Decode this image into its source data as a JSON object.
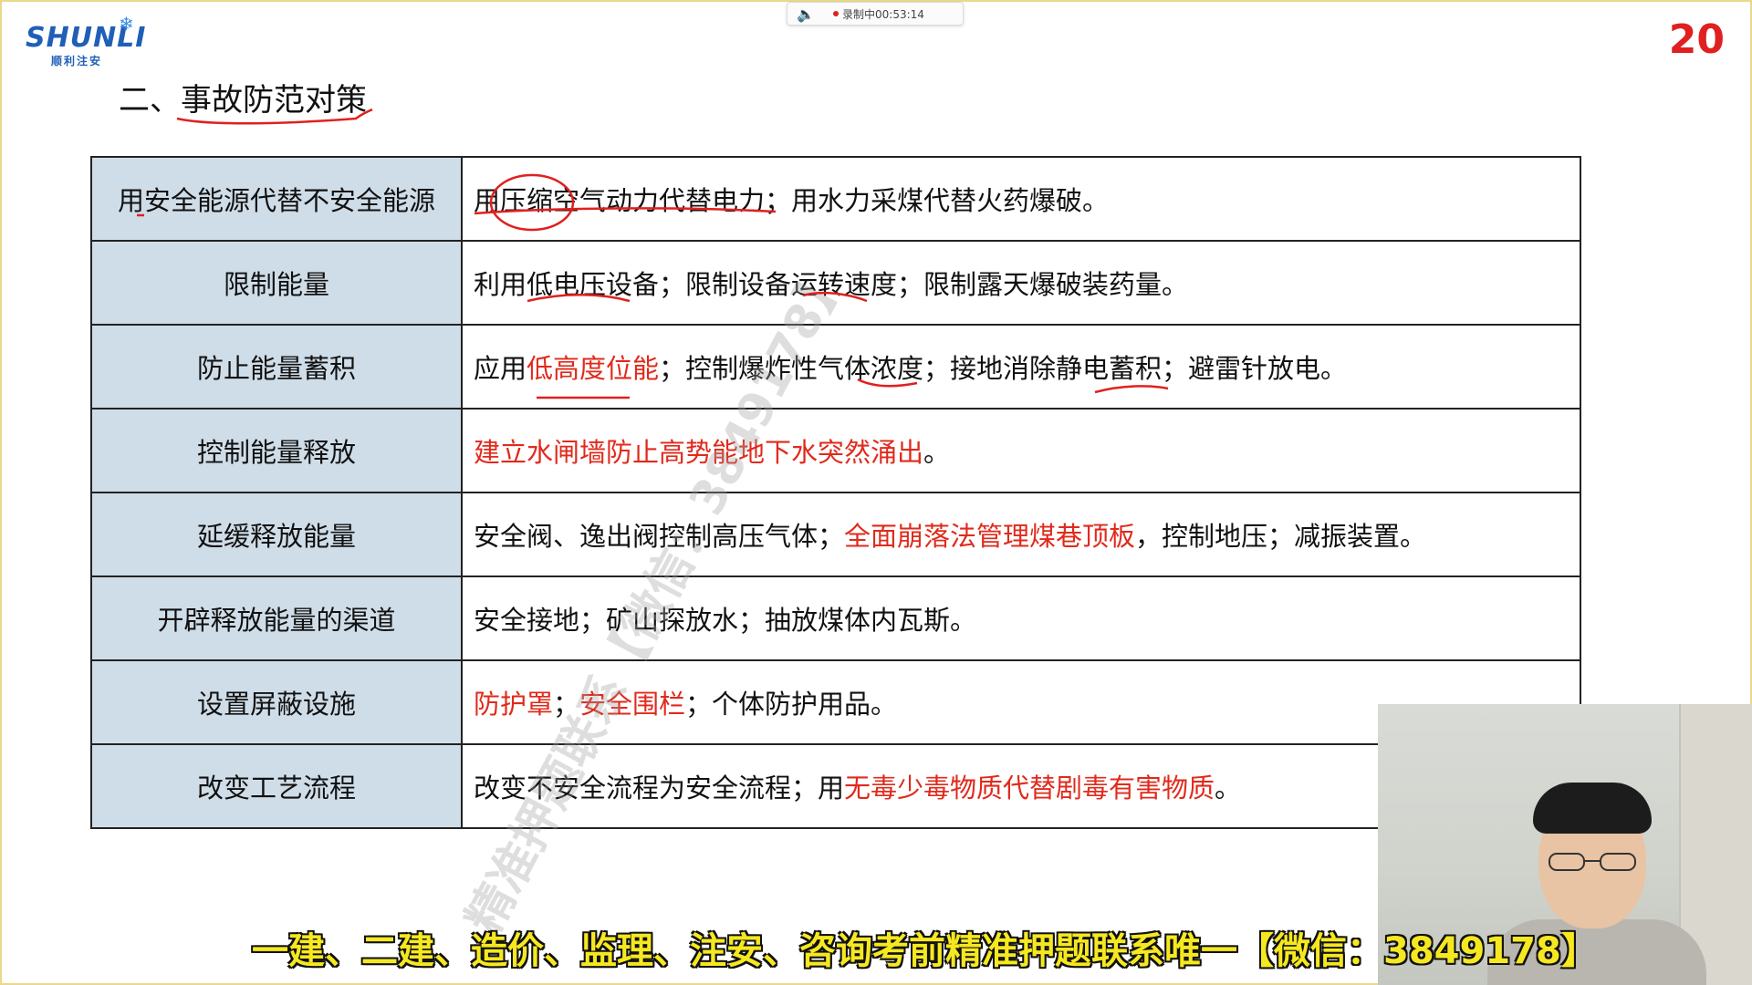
{
  "logo": {
    "word": "SHUNLI",
    "sub": "顺利注安"
  },
  "recording": {
    "status_text": "录制中00:53:14"
  },
  "page_number": "20",
  "section_title": "二、事故防范对策",
  "table_rows": [
    {
      "label": "用安全能源代替不安全能源",
      "segments": [
        {
          "text": "用压缩空气动力代替电力；用水力采煤代替火药爆破。",
          "red": false
        }
      ]
    },
    {
      "label": "限制能量",
      "segments": [
        {
          "text": "利用低电压设备；限制设备运转速度；限制露天爆破装药量。",
          "red": false
        }
      ]
    },
    {
      "label": "防止能量蓄积",
      "segments": [
        {
          "text": "应用",
          "red": false
        },
        {
          "text": "低高度位能",
          "red": true
        },
        {
          "text": "；控制爆炸性气体浓度；接地消除静电蓄积；避雷针放电。",
          "red": false
        }
      ]
    },
    {
      "label": "控制能量释放",
      "segments": [
        {
          "text": "建立水闸墙防止高势能地下水突然涌出",
          "red": true
        },
        {
          "text": "。",
          "red": false
        }
      ]
    },
    {
      "label": "延缓释放能量",
      "segments": [
        {
          "text": "安全阀、逸出阀控制高压气体；",
          "red": false
        },
        {
          "text": "全面崩落法管理煤巷顶板",
          "red": true
        },
        {
          "text": "，控制地压；减振装置。",
          "red": false
        }
      ]
    },
    {
      "label": "开辟释放能量的渠道",
      "segments": [
        {
          "text": "安全接地；矿山探放水；抽放煤体内瓦斯。",
          "red": false
        }
      ]
    },
    {
      "label": "设置屏蔽设施",
      "segments": [
        {
          "text": "防护罩",
          "red": true
        },
        {
          "text": "；",
          "red": false
        },
        {
          "text": "安全围栏",
          "red": true
        },
        {
          "text": "；个体防护用品。",
          "red": false
        }
      ]
    },
    {
      "label": "改变工艺流程",
      "segments": [
        {
          "text": "改变不安全流程为安全流程；用",
          "red": false
        },
        {
          "text": "无毒少毒物质代替剧毒有害物质",
          "red": true
        },
        {
          "text": "。",
          "red": false
        }
      ]
    }
  ],
  "watermark": "精准押题联系【微信：3849178】",
  "banner": "一建、二建、造价、监理、注安、咨询考前精准押题联系唯一【微信：3849178】",
  "colors": {
    "label_bg": "#cfdde8",
    "highlight_red": "#e02a1c",
    "banner_yellow": "#f6e820",
    "logo_blue": "#1f5fb8"
  },
  "icons": {
    "speaker": "speaker-icon",
    "logo_star": "snowflake-icon"
  }
}
